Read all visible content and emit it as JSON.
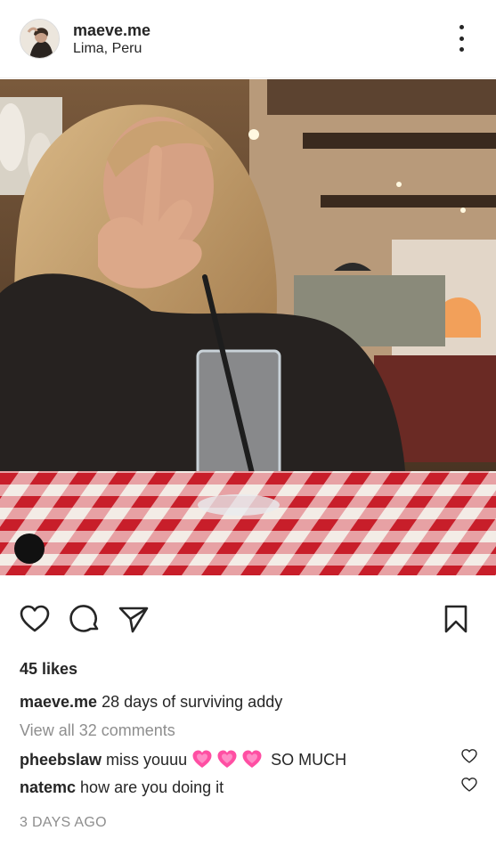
{
  "post": {
    "username": "maeve.me",
    "location": "Lima, Peru",
    "likes_text": "45 likes",
    "caption": {
      "user": "maeve.me",
      "text": "28 days of surviving addy"
    },
    "view_all_comments": "View all 32 comments",
    "comments": [
      {
        "user": "pheebslaw",
        "text_before": "miss youuu",
        "emoji": [
          "growing-heart",
          "growing-heart",
          "growing-heart"
        ],
        "text_after": "SO MUCH"
      },
      {
        "user": "natemc",
        "text": "how are you doing it"
      }
    ],
    "timestamp": "3 DAYS AGO"
  },
  "icons": {
    "more": "more-options-icon",
    "like": "heart-outline-icon",
    "comment": "comment-bubble-icon",
    "share": "paper-plane-icon",
    "save": "bookmark-icon",
    "tag": "user-tag-indicator"
  },
  "colors": {
    "text": "#262626",
    "secondary_text": "#8e8e8e",
    "emoji_heart": "#ff4fa3"
  }
}
